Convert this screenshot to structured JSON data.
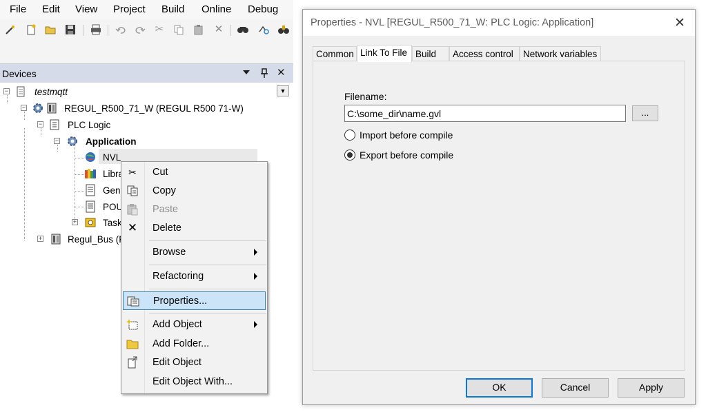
{
  "menubar": {
    "items": [
      "File",
      "Edit",
      "View",
      "Project",
      "Build",
      "Online",
      "Debug"
    ]
  },
  "toolbar": {
    "icons": [
      "wand-icon",
      "new-file-icon",
      "open-folder-icon",
      "save-icon",
      "print-icon",
      "undo-icon",
      "redo-icon",
      "cut-icon",
      "copy-icon",
      "paste-icon",
      "delete-icon",
      "find-icon",
      "replace-icon",
      "binoculars-icon"
    ]
  },
  "devices_panel": {
    "title": "Devices",
    "pin_glyph": "▾",
    "dock_glyph": "ᵖ",
    "close_glyph": "✕"
  },
  "tree": {
    "project": "testmqtt",
    "device": "REGUL_R500_71_W (REGUL R500 71-W)",
    "plc_logic": "PLC Logic",
    "application": "Application",
    "nvl": "NVL",
    "library": "Libra",
    "gvl": "Gene",
    "pou": "POU",
    "task": "Task",
    "bus": "Regul_Bus (F"
  },
  "context_menu": {
    "items": [
      {
        "label": "Cut",
        "icon": "scissors-icon",
        "glyph": "✂",
        "enabled": true
      },
      {
        "label": "Copy",
        "icon": "copy-icon",
        "glyph": "⎘",
        "enabled": true
      },
      {
        "label": "Paste",
        "icon": "paste-icon",
        "glyph": "▤",
        "enabled": false
      },
      {
        "label": "Delete",
        "icon": "delete-icon",
        "glyph": "✕",
        "enabled": true
      },
      {
        "label": "Browse",
        "has_submenu": true
      },
      {
        "label": "Refactoring",
        "has_submenu": true
      },
      {
        "label": "Properties...",
        "icon": "properties-icon",
        "glyph": "▦",
        "selected": true
      },
      {
        "label": "Add Object",
        "icon": "add-object-icon",
        "glyph": "✣",
        "has_submenu": true
      },
      {
        "label": "Add Folder...",
        "icon": "folder-icon",
        "glyph": "▭"
      },
      {
        "label": "Edit Object",
        "icon": "edit-object-icon",
        "glyph": "⎘"
      },
      {
        "label": "Edit Object With..."
      }
    ]
  },
  "dialog": {
    "title": "Properties - NVL [REGUL_R500_71_W: PLC Logic: Application]",
    "close_glyph": "✕",
    "tabs": [
      "Common",
      "Link To File",
      "Build",
      "Access control",
      "Network variables"
    ],
    "active_tab": "Link To File",
    "filename_label": "Filename:",
    "filename_value": "C:\\some_dir\\name.gvl",
    "browse_label": "...",
    "import_label": "Import before compile",
    "import_selected": false,
    "export_label": "Export before compile",
    "export_selected": true,
    "buttons": {
      "ok": "OK",
      "cancel": "Cancel",
      "apply": "Apply"
    }
  },
  "colors": {
    "accent": "#0a78d7",
    "selection": "#cce4f7",
    "devices_header": "#d6dbe9"
  }
}
